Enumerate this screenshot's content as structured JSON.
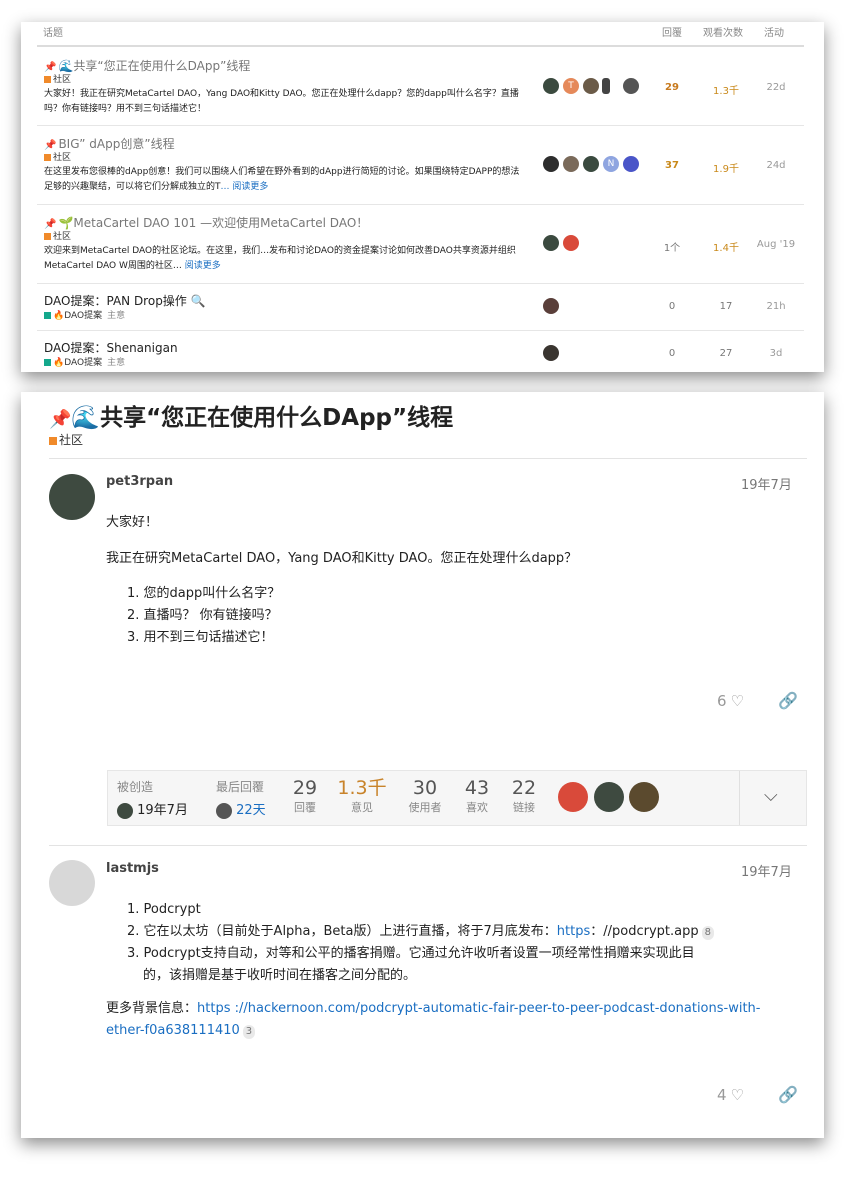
{
  "list": {
    "headers": {
      "topic": "话题",
      "replies": "回覆",
      "views": "观看次数",
      "activity": "活动"
    },
    "rows": [
      {
        "title": "共享“您正在使用什么DApp”线程",
        "category": "社区",
        "excerpt": "大家好！我正在研究MetaCartel DAO，Yang DAO和Kitty DAO。您正在处理什么dapp？您的dapp叫什么名字？直播吗？你有链接吗？用不到三句话描述它！",
        "replies": "29",
        "views": "1.3千",
        "activity": "22d",
        "avatar_letters": [
          "",
          "T",
          "",
          "",
          ""
        ]
      },
      {
        "title": "BIG” dApp创意”线程",
        "category": "社区",
        "excerpt": "在这里发布您很棒的dApp创意！我们可以围绕人们希望在野外看到的dApp进行简短的讨论。如果围绕特定DAPP的想法足够的兴趣聚结，可以将它们分解成独立的T",
        "more": "… 阅读更多",
        "replies": "37",
        "views": "1.9千",
        "activity": "24d",
        "avatar_letters": [
          "",
          "",
          "",
          "N",
          ""
        ]
      },
      {
        "title": "MetaCartel DAO 101 —欢迎使用MetaCartel DAO！",
        "category": "社区",
        "excerpt": "欢迎来到MetaCartel DAO的社区论坛。在这里，我们…发布和讨论DAO的资金提案讨论如何改善DAO共享资源并组织MetaCartel DAO W周围的社区…",
        "more": "阅读更多",
        "replies": "1个",
        "views": "1.4千",
        "activity": "Aug '19"
      },
      {
        "title": "DAO提案：PAN Drop操作",
        "category": "DAO提案",
        "tag": "主意",
        "replies": "0",
        "views": "17",
        "activity": "21h"
      },
      {
        "title": "DAO提案：Shenanigan",
        "category": "DAO提案",
        "tag": "主意",
        "replies": "0",
        "views": "27",
        "activity": "3d"
      }
    ]
  },
  "topic": {
    "title": "共享“您正在使用什么DApp”线程",
    "category": "社区",
    "posts": [
      {
        "username": "pet3rpan",
        "date": "19年7月",
        "greeting": "大家好！",
        "body": "我正在研究MetaCartel DAO，Yang DAO和Kitty DAO。您正在处理什么dapp？",
        "list": [
          "您的dapp叫什么名字？",
          "直播吗？ 你有链接吗？",
          "用不到三句话描述它！"
        ],
        "likes": "6"
      },
      {
        "username": "lastmjs",
        "date": "19年7月",
        "list": [
          "Podcrypt",
          "它在以太坊（目前处于Alpha，Beta版）上进行直播，将于7月底发布：",
          "Podcrypt支持自动，对等和公平的播客捐赠。它通过允许收听者设置一项经常性捐赠来实现此目",
          "的，该捐赠是基于收听时间在播客之间分配的。"
        ],
        "link1": "https",
        "link1_rest": "：//podcrypt.app",
        "link1_count": "8",
        "more_label": "更多背景信息：",
        "link2_a": "https ://hackernoon.com/podcrypt-automatic-fair-peer-to-peer-podcast-donations-with-",
        "link2_b": "ether-f0a638111410",
        "link2_count": "3",
        "likes": "4"
      }
    ],
    "summary": {
      "created_label": "被创造",
      "created_value": "19年7月",
      "last_reply_label": "最后回覆",
      "last_reply_value": "22天",
      "stats": [
        {
          "n": "29",
          "l": "回覆"
        },
        {
          "n": "1.3千",
          "l": "意见"
        },
        {
          "n": "30",
          "l": "使用者"
        },
        {
          "n": "43",
          "l": "喜欢"
        },
        {
          "n": "22",
          "l": "链接"
        }
      ]
    }
  },
  "icons": {
    "pin": "pin-icon",
    "wave": "wave-icon",
    "sprout": "sprout-icon",
    "fire": "fire-icon",
    "search": "magnifier-icon",
    "heart": "heart-icon",
    "link": "link-icon",
    "chevron": "chevron-down-icon"
  },
  "colors": {
    "category_orange": "#f08a2a",
    "dao_teal": "#14a88c",
    "link_blue": "#1a6ec2",
    "views_orange": "#c8832a"
  }
}
